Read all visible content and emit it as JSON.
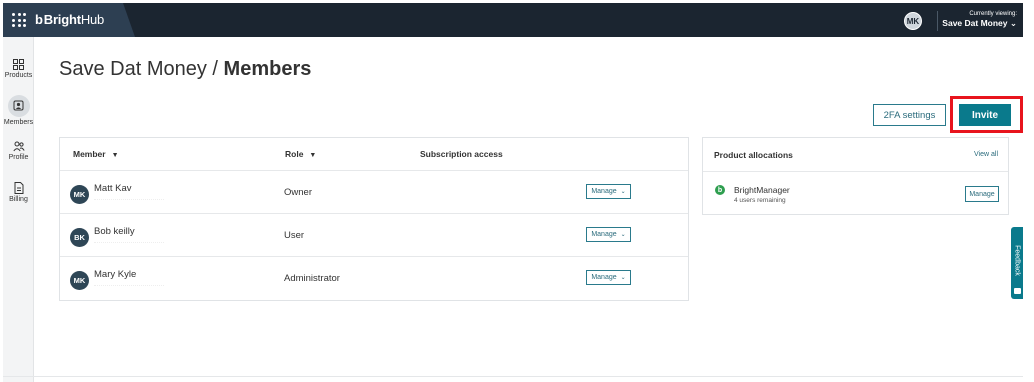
{
  "topbar": {
    "brand_prefix": "b",
    "brand_bright": "Bright",
    "brand_hub": "Hub",
    "user_initials": "MK",
    "viewing_label": "Currently viewing:",
    "viewing_value": "Save Dat Money",
    "viewing_chevron": "chevron-down-icon"
  },
  "sidebar": {
    "items": [
      {
        "label": "Products",
        "icon": "grid-icon"
      },
      {
        "label": "Members",
        "icon": "members-icon",
        "active": true
      },
      {
        "label": "Profile",
        "icon": "profile-icon"
      },
      {
        "label": "Billing",
        "icon": "document-icon"
      }
    ]
  },
  "page": {
    "title_parent": "Save Dat Money",
    "title_sep": " / ",
    "title_current": "Members"
  },
  "actions": {
    "twofa_label": "2FA settings",
    "invite_label": "Invite",
    "highlight_color": "#e8141d"
  },
  "members": {
    "headers": {
      "member": "Member",
      "role": "Role",
      "subscription": "Subscription access"
    },
    "rows": [
      {
        "initials": "MK",
        "name": "Matt Kav",
        "role": "Owner",
        "manage": "Manage"
      },
      {
        "initials": "BK",
        "name": "Bob keilly",
        "role": "User",
        "manage": "Manage"
      },
      {
        "initials": "MK",
        "name": "Mary Kyle",
        "role": "Administrator",
        "manage": "Manage"
      }
    ]
  },
  "allocations": {
    "title": "Product allocations",
    "view_all": "View all",
    "product": {
      "icon_letter": "b",
      "name": "BrightManager",
      "remaining": "4 users remaining",
      "manage": "Manage"
    }
  },
  "feedback": {
    "label": "Feedback"
  },
  "colors": {
    "topbar": "#1b2530",
    "accent": "#0a7a8c",
    "avatar": "#2e4656",
    "product_green": "#2e9e4f"
  }
}
